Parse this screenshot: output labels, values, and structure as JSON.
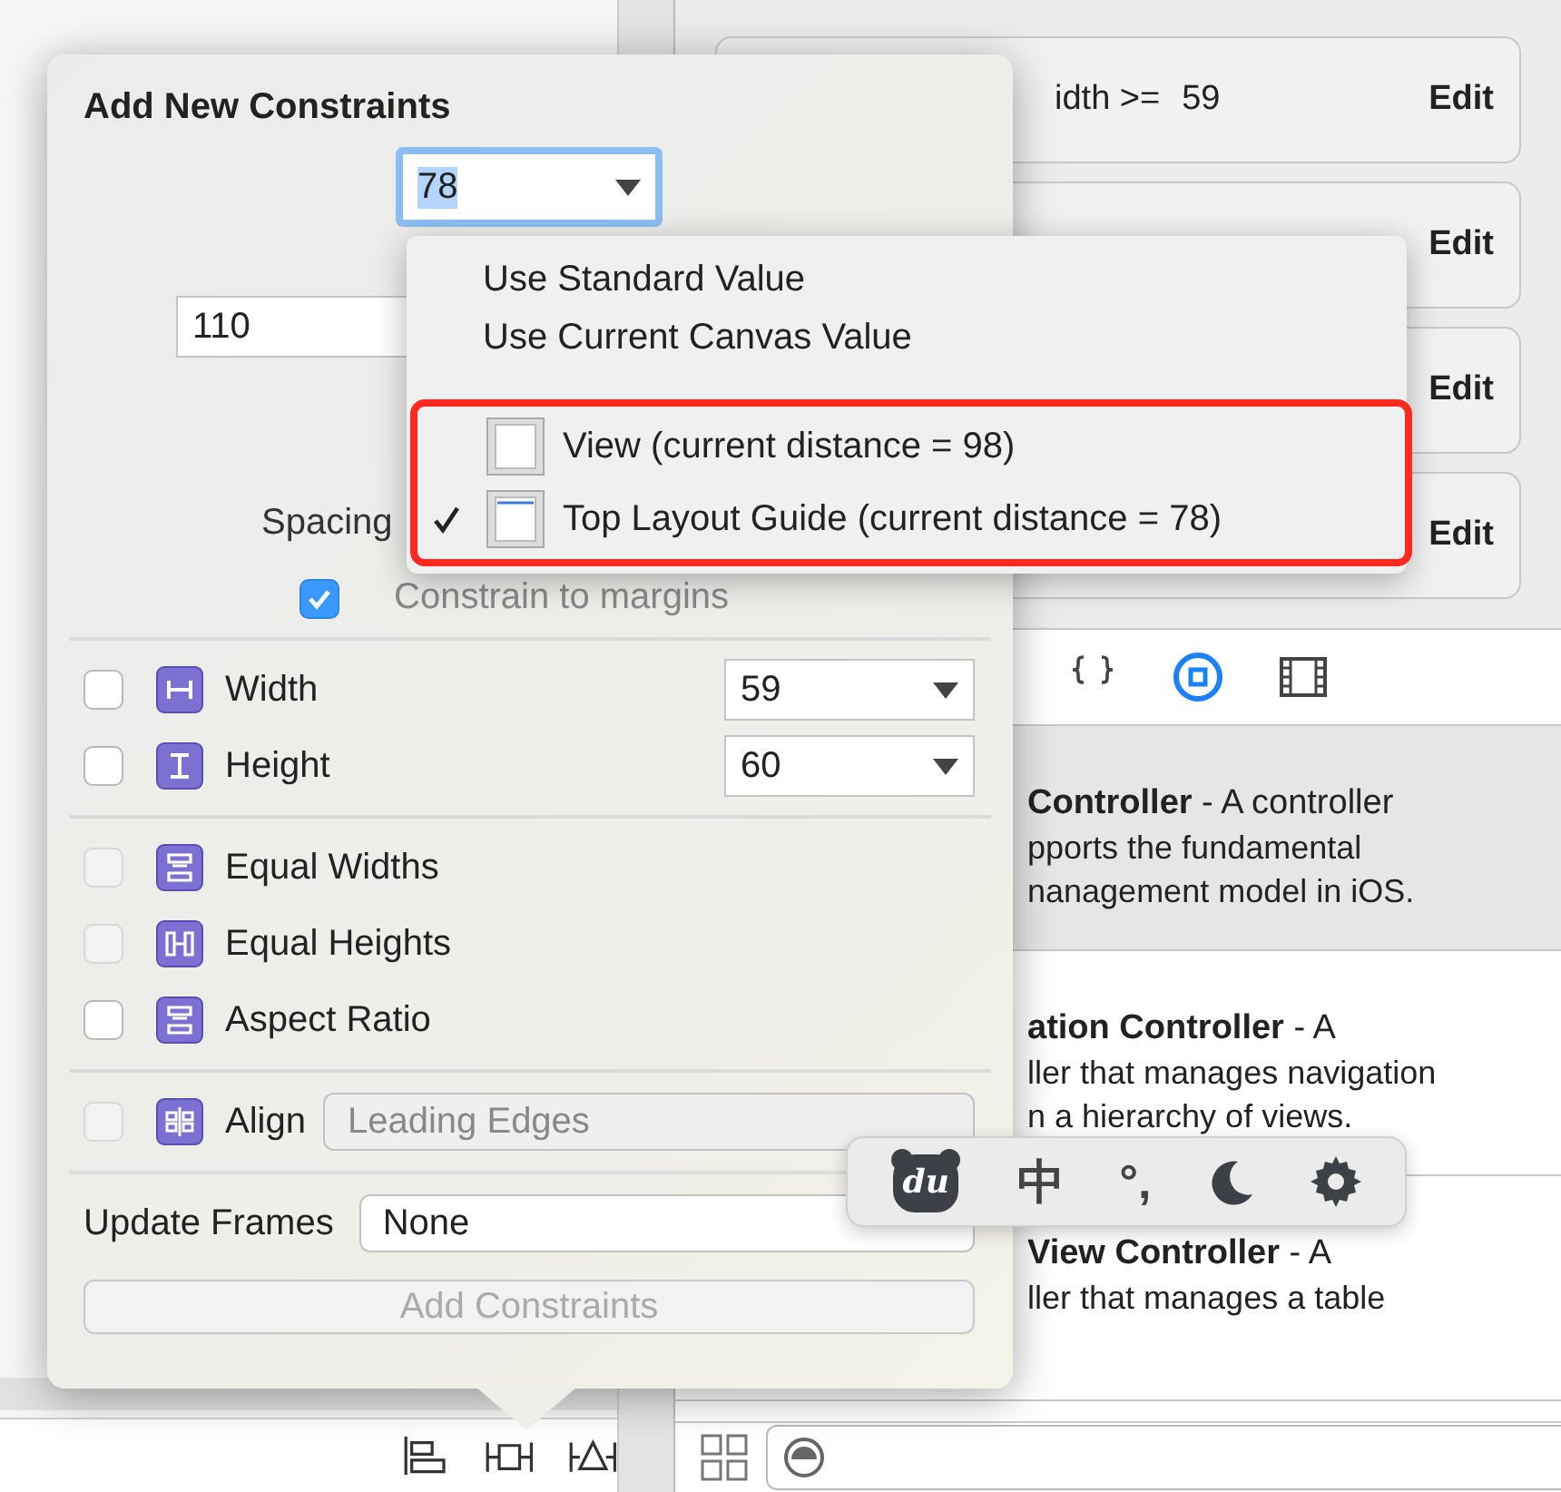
{
  "constraints_list": {
    "rows": [
      {
        "text": "idth >=",
        "value": "59",
        "action": "Edit"
      },
      {
        "action": "Edit"
      },
      {
        "action": "Edit"
      },
      {
        "action": "Edit"
      }
    ]
  },
  "library_toolbar": {
    "tabs": [
      {
        "kind": "code",
        "selected": false
      },
      {
        "kind": "object",
        "selected": true
      },
      {
        "kind": "media",
        "selected": false
      }
    ]
  },
  "library_items": [
    {
      "title": "**Controller** - A controller",
      "lines": [
        "pports the fundamental",
        "nanagement model in iOS."
      ],
      "selected": true
    },
    {
      "title": "**ation Controller** - A",
      "lines": [
        "ller that manages navigation",
        "n a hierarchy of views."
      ],
      "selected": false
    },
    {
      "title": "**View Controller** - A",
      "lines": [
        "ller that manages a table"
      ],
      "selected": false
    }
  ],
  "popover": {
    "title": "Add New Constraints",
    "top_field": {
      "value": "78",
      "focused": true
    },
    "left_field": {
      "value": "110"
    },
    "spacing_label": "Spacing",
    "margins": {
      "label": "Constrain to margins",
      "checked": true
    },
    "size_rows": [
      {
        "kind": "width",
        "label": "Width",
        "checked": false,
        "value": "59"
      },
      {
        "kind": "height",
        "label": "Height",
        "checked": false,
        "value": "60"
      }
    ],
    "equal_rows": [
      {
        "kind": "equal-widths",
        "label": "Equal Widths",
        "checked": false,
        "disabled": true
      },
      {
        "kind": "equal-heights",
        "label": "Equal Heights",
        "checked": false,
        "disabled": true
      },
      {
        "kind": "aspect-ratio",
        "label": "Aspect Ratio",
        "checked": false,
        "disabled": false
      }
    ],
    "align": {
      "label": "Align",
      "checked": false,
      "disabled": true,
      "value": "Leading Edges"
    },
    "update_frames": {
      "label": "Update Frames",
      "value": "None"
    },
    "add_button": {
      "label": "Add Constraints",
      "disabled": true
    }
  },
  "menu": {
    "groups": [
      {
        "outlined": false,
        "items": [
          {
            "label": "Use Standard Value",
            "checked": false
          },
          {
            "label": "Use Current Canvas Value",
            "checked": false
          }
        ]
      },
      {
        "outlined": true,
        "items": [
          {
            "label": "View (current distance = 98)",
            "checked": false,
            "kind": "view"
          },
          {
            "label": "Top Layout Guide (current distance = 78)",
            "checked": true,
            "kind": "top-guide"
          }
        ]
      }
    ]
  },
  "ime_bar": {
    "items": [
      {
        "kind": "logo",
        "text": "du"
      },
      {
        "kind": "char",
        "text": "中"
      },
      {
        "kind": "char",
        "text": "°,"
      },
      {
        "kind": "moon"
      },
      {
        "kind": "gear"
      }
    ]
  },
  "bottom_toolbar": {
    "tools": [
      {
        "kind": "align"
      },
      {
        "kind": "pin"
      },
      {
        "kind": "resolve"
      }
    ]
  },
  "library_footer": {
    "icons": [
      {
        "kind": "grid"
      },
      {
        "kind": "filter"
      }
    ]
  }
}
